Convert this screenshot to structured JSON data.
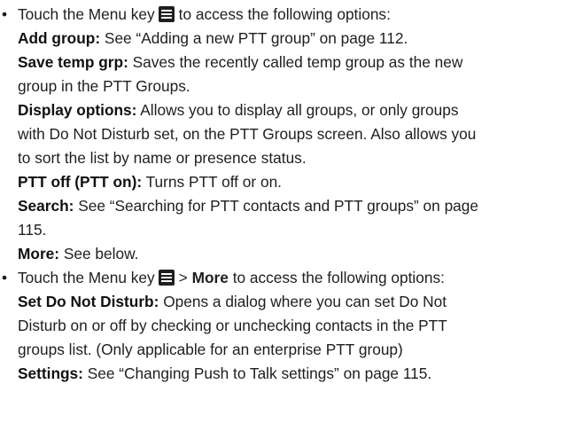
{
  "bullets": [
    {
      "bullet_char": "•",
      "intro_prefix": "Touch the Menu key",
      "intro_suffix": "to access the following options:",
      "options": [
        {
          "label": "Add group:",
          "lines": [
            "See “Adding a new PTT group” on page 112."
          ]
        },
        {
          "label": "Save temp grp:",
          "lines": [
            "Saves the recently called temp group as the new",
            "group in the PTT Groups."
          ]
        },
        {
          "label": "Display options:",
          "lines": [
            "Allows you to display all groups, or only groups",
            "with Do Not Disturb set, on the PTT Groups screen. Also allows you",
            "to sort the list by name or presence status."
          ]
        },
        {
          "label": "PTT off (PTT on):",
          "lines": [
            "Turns PTT off or on."
          ]
        },
        {
          "label": "Search:",
          "lines": [
            "See “Searching for PTT contacts and PTT groups” on page",
            "115."
          ]
        },
        {
          "label": "More:",
          "lines": [
            "See below."
          ]
        }
      ]
    },
    {
      "bullet_char": "•",
      "intro_prefix": "Touch the Menu key",
      "intro_gt": ">",
      "intro_bold": "More",
      "intro_suffix": "to access the following options:",
      "options": [
        {
          "label": "Set Do Not Disturb:",
          "lines": [
            "Opens a dialog where you can set Do Not",
            "Disturb on or off by checking or unchecking contacts in the PTT",
            "groups list. (Only applicable for an enterprise PTT group)"
          ]
        },
        {
          "label": "Settings:",
          "lines": [
            "See “Changing Push to Talk settings” on page 115."
          ]
        }
      ]
    }
  ]
}
